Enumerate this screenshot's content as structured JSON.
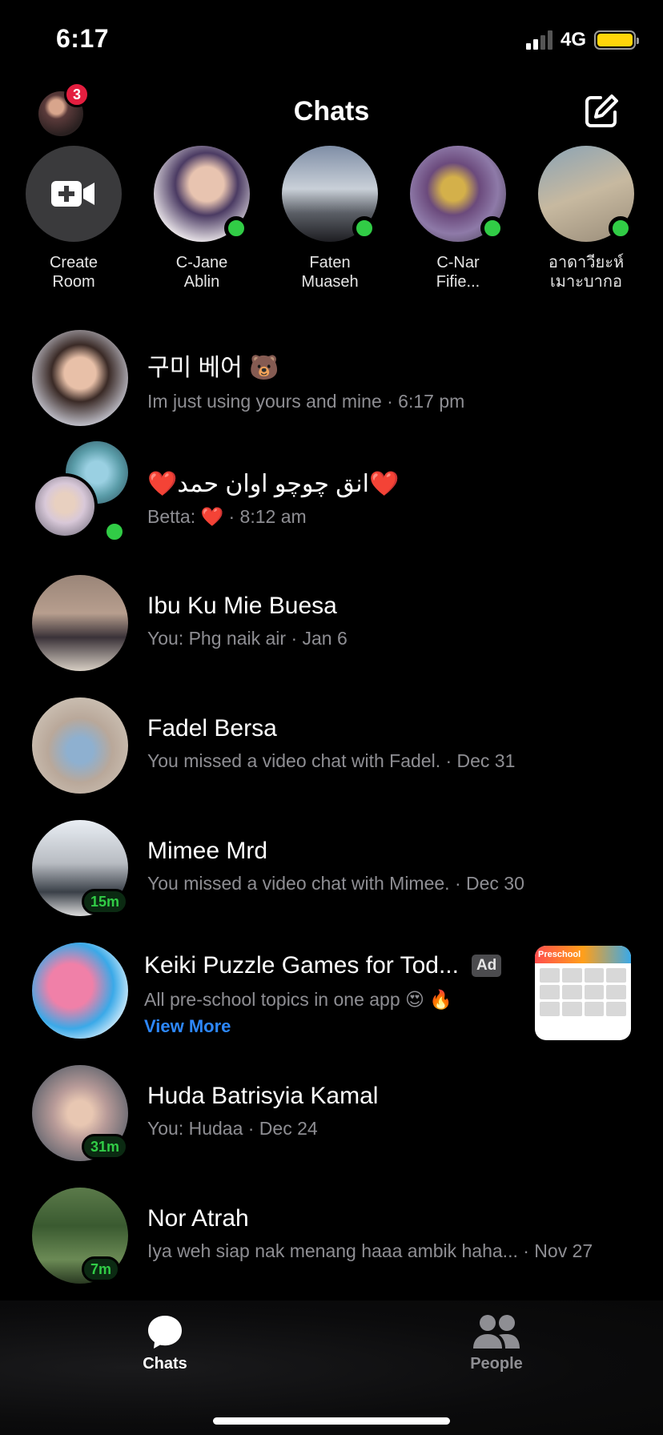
{
  "status": {
    "time": "6:17",
    "network": "4G"
  },
  "header": {
    "title": "Chats",
    "badge_count": "3"
  },
  "stories": [
    {
      "label": "Create\nRoom",
      "type": "create"
    },
    {
      "label": "C-Jane\nAblin",
      "online": true
    },
    {
      "label": "Faten\nMuaseh",
      "online": true
    },
    {
      "label": "C-Nar\nFifie...",
      "online": true
    },
    {
      "label": "อาดาวียะห์\nเมาะบากอ",
      "online": true
    }
  ],
  "chats": [
    {
      "name": "구미 베어 🐻",
      "preview": "Im just using yours and mine · 6:17 pm"
    },
    {
      "name": "❤️انق چوچو اوان حمد❤️",
      "preview": "Betta: ❤️ · 8:12 am"
    },
    {
      "name": "Ibu Ku Mie Buesa",
      "preview": "You: Phg naik air · Jan 6"
    },
    {
      "name": "Fadel Bersa",
      "preview": "You missed a video chat with Fadel. · Dec 31"
    },
    {
      "name": "Mimee Mrd",
      "preview": "You missed a video chat with Mimee. · Dec 30",
      "active": "15m"
    },
    {
      "name": "Huda Batrisyia Kamal",
      "preview": "You: Hudaa · Dec 24",
      "active": "31m"
    },
    {
      "name": "Nor Atrah",
      "preview": "Iya weh siap nak menang haaa ambik haha... · Nov 27",
      "active": "7m"
    }
  ],
  "ad": {
    "name": "Keiki Puzzle Games for Tod...",
    "tag": "Ad",
    "description": "All pre-school topics in one app 😍 🔥",
    "link": "View More",
    "thumb_title": "Preschool"
  },
  "tabs": {
    "chats": "Chats",
    "people": "People"
  },
  "colors": {
    "online": "#31cc46",
    "badge": "#e41e3f",
    "link": "#2d88ff",
    "battery": "#ffd60a"
  }
}
